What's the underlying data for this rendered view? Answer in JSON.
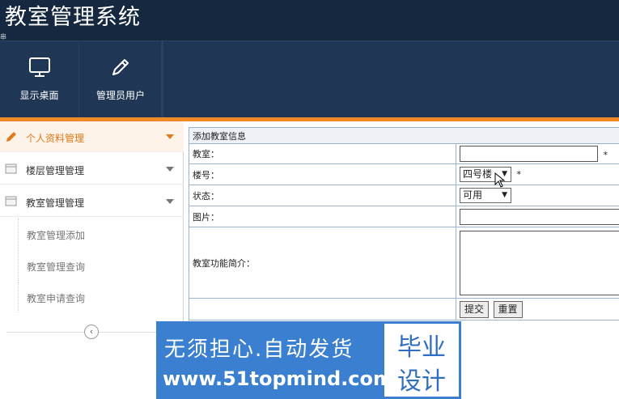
{
  "app": {
    "title": "教室管理系统",
    "side_glyph": "串"
  },
  "toolbar": {
    "items": [
      {
        "label": "显示桌面",
        "icon": "monitor-icon"
      },
      {
        "label": "管理员用户",
        "icon": "pencil-icon"
      }
    ]
  },
  "sidebar": {
    "items": [
      {
        "label": "个人资料管理",
        "icon": "pencil-icon",
        "active": true
      },
      {
        "label": "楼层管理管理",
        "icon": "window-icon",
        "active": false
      },
      {
        "label": "教室管理管理",
        "icon": "window-icon",
        "active": false
      }
    ],
    "subitems": [
      {
        "label": "教室管理添加"
      },
      {
        "label": "教室管理查询"
      },
      {
        "label": "教室申请查询"
      }
    ],
    "collapse_icon": "chevron-left-icon"
  },
  "form": {
    "caption": "添加教室信息",
    "fields": {
      "classroom_label": "教室：",
      "building_label": "楼号：",
      "status_label": "状态：",
      "image_label": "图片：",
      "intro_label": "教室功能简介："
    },
    "building_value": "四号楼",
    "status_value": "可用",
    "required_mark": "*",
    "submit_label": "提交",
    "reset_label": "重置"
  },
  "watermark": {
    "line1": "无须担心.自动发货",
    "line2": "www.51topmind.com",
    "badge_top": "毕业",
    "badge_bottom": "设计"
  },
  "colors": {
    "header_bg": "#16283f",
    "toolbar_bg": "#1f3654",
    "accent": "#f08a24",
    "watermark_bg": "#3a7fd0"
  }
}
